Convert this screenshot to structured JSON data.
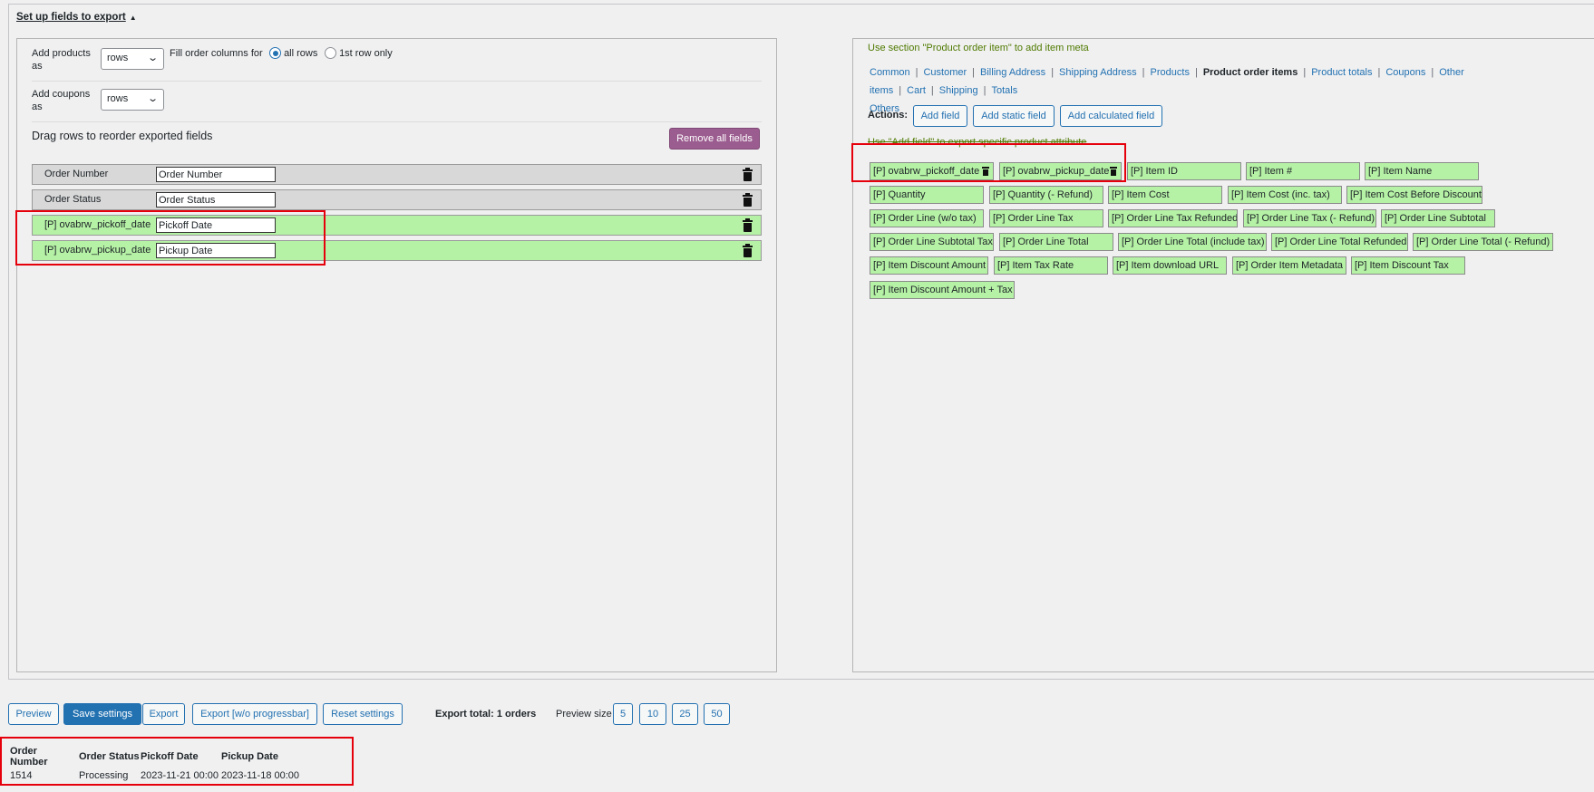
{
  "setup": {
    "title": "Set up fields to export",
    "caret": "▲"
  },
  "left": {
    "add_products_label": "Add products as",
    "add_products_value": "rows",
    "fill_label": "Fill order columns for",
    "radio_all": "all rows",
    "radio_first": "1st row only",
    "add_coupons_label": "Add coupons as",
    "add_coupons_value": "rows",
    "drag_label": "Drag rows to reorder exported fields",
    "remove_all": "Remove all fields",
    "rows": [
      {
        "key": "Order Number",
        "value": "Order Number",
        "style": "gray"
      },
      {
        "key": "Order Status",
        "value": "Order Status",
        "style": "gray"
      },
      {
        "key": "[P] ovabrw_pickoff_date",
        "value": "Pickoff Date",
        "style": "green"
      },
      {
        "key": "[P] ovabrw_pickup_date",
        "value": "Pickup Date",
        "style": "green"
      }
    ]
  },
  "right": {
    "hint": "Use section \"Product order item\" to add item meta",
    "tabs": [
      "Common",
      "Customer",
      "Billing Address",
      "Shipping Address",
      "Products",
      "Product order items",
      "Product totals",
      "Coupons",
      "Other items",
      "Cart",
      "Shipping",
      "Totals",
      "Others"
    ],
    "active_tab": "Product order items",
    "actions_label": "Actions:",
    "add_field": "Add field",
    "add_static": "Add static field",
    "add_calc": "Add calculated field",
    "hint2": "Use \"Add field\" to export specific product attribute",
    "chips": [
      "[P] ovabrw_pickoff_date",
      "[P] ovabrw_pickup_date",
      "[P] Item ID",
      "[P] Item #",
      "[P] Item Name",
      "[P] Quantity",
      "[P] Quantity (- Refund)",
      "[P] Item Cost",
      "[P] Item Cost (inc. tax)",
      "[P] Item Cost Before Discount",
      "[P] Order Line (w/o tax)",
      "[P] Order Line Tax",
      "[P] Order Line Tax Refunded",
      "[P] Order Line Tax (- Refund)",
      "[P] Order Line Subtotal",
      "[P] Order Line Subtotal Tax",
      "[P] Order Line Total",
      "[P] Order Line Total (include tax)",
      "[P] Order Line Total Refunded",
      "[P] Order Line Total (- Refund)",
      "[P] Item Discount Amount",
      "[P] Item Tax Rate",
      "[P] Item download URL",
      "[P] Order Item Metadata",
      "[P] Item Discount Tax",
      "[P] Item Discount Amount + Tax"
    ]
  },
  "bottom": {
    "preview": "Preview",
    "save": "Save settings",
    "export": "Export",
    "export_nobar": "Export [w/o progressbar]",
    "reset": "Reset settings",
    "export_total": "Export total: 1 orders",
    "preview_size": "Preview size",
    "sizes": [
      "5",
      "10",
      "25",
      "50"
    ]
  },
  "preview_table": {
    "headers": [
      "Order Number",
      "Order Status",
      "Pickoff Date",
      "Pickup Date"
    ],
    "row": [
      "1514",
      "Processing",
      "2023-11-21 00:00",
      "2023-11-18 00:00"
    ]
  }
}
